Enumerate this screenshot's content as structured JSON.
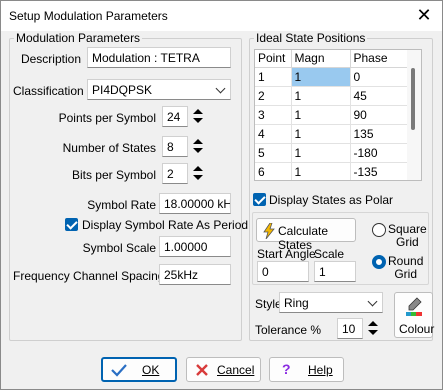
{
  "window": {
    "title": "Setup Modulation Parameters",
    "close": "✕"
  },
  "modulation": {
    "legend": "Modulation Parameters",
    "description_label": "Description",
    "description_value": "Modulation : TETRA",
    "classification_label": "Classification",
    "classification_value": "PI4DQPSK",
    "points_label": "Points per Symbol",
    "points_value": "24",
    "states_label": "Number of States",
    "states_value": "8",
    "bits_label": "Bits per Symbol",
    "bits_value": "2",
    "rate_label": "Symbol Rate",
    "rate_value": "18.00000 kHz",
    "period_label": "Display Symbol Rate As Period",
    "scale_label": "Symbol Scale",
    "scale_value": "1.00000",
    "spacing_label": "Frequency Channel Spacing",
    "spacing_value": "25kHz"
  },
  "ideal": {
    "legend": "Ideal State Positions",
    "columns": [
      "Point",
      "Magn",
      "Phase"
    ],
    "rows": [
      [
        "1",
        "1",
        "0"
      ],
      [
        "2",
        "1",
        "45"
      ],
      [
        "3",
        "1",
        "90"
      ],
      [
        "4",
        "1",
        "135"
      ],
      [
        "5",
        "1",
        "-180"
      ],
      [
        "6",
        "1",
        "-135"
      ]
    ],
    "polar_label": "Display States as Polar",
    "calc_label": "Calculate States",
    "square_label": "Square\nGrid",
    "round_label": "Round\nGrid",
    "start_angle_label": "Start Angle",
    "start_angle_value": "0",
    "scale_label": "Scale",
    "scale_value": "1",
    "style_label": "Style",
    "style_value": "Ring",
    "tolerance_label": "Tolerance %",
    "tolerance_value": "10",
    "colour_label": "Colour"
  },
  "buttons": {
    "ok": "OK",
    "cancel": "Cancel",
    "help": "Help"
  },
  "colors": {
    "accent": "#0063b1",
    "selection": "#99c9ef"
  }
}
